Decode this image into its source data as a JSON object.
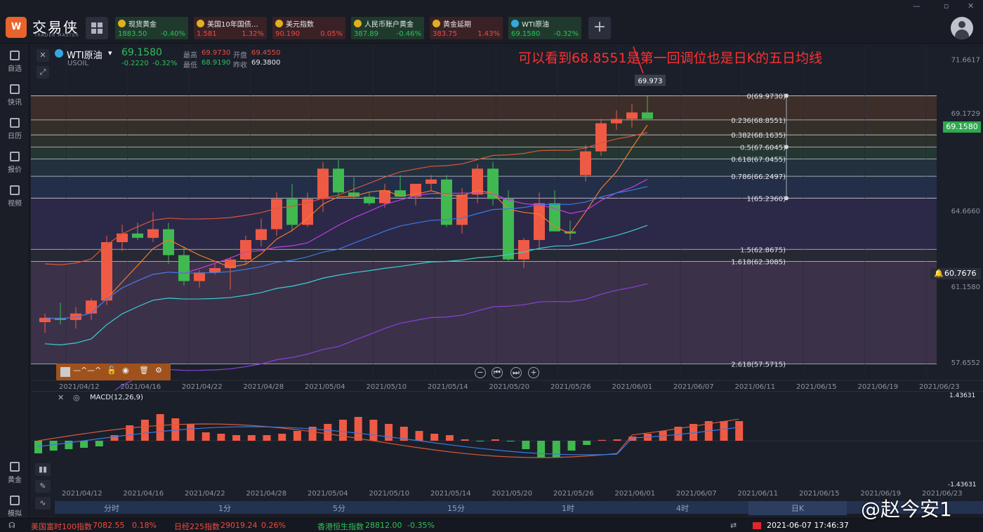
{
  "app": {
    "logo_text": "交易侠",
    "logo_sub": "TRADER MASTER"
  },
  "tickers": [
    {
      "name": "现货黄金",
      "price": "1883.50",
      "change": "-0.40%",
      "color": "#2ec05a",
      "bg": "#1f3a2c"
    },
    {
      "name": "美国10年国债…",
      "price": "1.581",
      "change": "1.32%",
      "color": "#ef4b3f",
      "bg": "#3a2126"
    },
    {
      "name": "美元指数",
      "price": "90.190",
      "change": "0.05%",
      "color": "#ef4b3f",
      "bg": "#3a2126"
    },
    {
      "name": "人民币账户黄金",
      "price": "387.89",
      "change": "-0.46%",
      "color": "#2ec05a",
      "bg": "#1f3a2c"
    },
    {
      "name": "黄金延期",
      "price": "383.75",
      "change": "1.43%",
      "color": "#ef4b3f",
      "bg": "#3a2126"
    },
    {
      "name": "WTI原油",
      "price": "69.1580",
      "change": "-0.32%",
      "color": "#2ec05a",
      "bg": "#1f3a2c"
    }
  ],
  "sidebar": [
    {
      "label": "自选"
    },
    {
      "label": "快讯"
    },
    {
      "label": "日历"
    },
    {
      "label": "报价"
    },
    {
      "label": "视频"
    },
    {
      "label": "黄金"
    },
    {
      "label": "模拟"
    }
  ],
  "symbol": {
    "name": "WTI原油",
    "code": "USOIL",
    "price": "69.1580",
    "change": "-0.2220",
    "change_pct": "-0.32%",
    "high_label": "最高",
    "high": "69.9730",
    "open_label": "开盘",
    "open": "69.4550",
    "low_label": "最低",
    "low": "68.9190",
    "prev_label": "昨收",
    "prev": "69.3800"
  },
  "annotation": "可以看到68.8551是第一回调位也是日K的五日均线",
  "callout_value": "69.973",
  "current_price_tag": "69.1580",
  "alert_price": "60.7676",
  "price_axis": [
    "71.6617",
    "69.1729",
    "64.6660",
    "61.1580",
    "57.6552"
  ],
  "fib_levels": [
    {
      "label": "0(69.9730)",
      "value": 69.973
    },
    {
      "label": "0.236(68.8551)",
      "value": 68.8551
    },
    {
      "label": "0.382(68.1635)",
      "value": 68.1635
    },
    {
      "label": "0.5(67.6045)",
      "value": 67.6045
    },
    {
      "label": "0.618(67.0455)",
      "value": 67.0455
    },
    {
      "label": "0.786(66.2497)",
      "value": 66.2497
    },
    {
      "label": "1(65.2360)",
      "value": 65.236
    },
    {
      "label": "1.5(62.8675)",
      "value": 62.8675
    },
    {
      "label": "1.618(62.3085)",
      "value": 62.3085
    },
    {
      "label": "2.618(57.5715)",
      "value": 57.5715
    }
  ],
  "date_axis": [
    "2021/04/12",
    "2021/04/16",
    "2021/04/22",
    "2021/04/28",
    "2021/05/04",
    "2021/05/10",
    "2021/05/14",
    "2021/05/20",
    "2021/05/26",
    "2021/06/01",
    "2021/06/07",
    "2021/06/11",
    "2021/06/15",
    "2021/06/19",
    "2021/06/23"
  ],
  "macd": {
    "label": "MACD(12,26,9)",
    "top": "1.43631",
    "bottom": "-1.43631"
  },
  "timeframes": [
    "分时",
    "1分",
    "5分",
    "15分",
    "1时",
    "4时",
    "日K"
  ],
  "active_timeframe": "日K",
  "footer": {
    "items": [
      {
        "name": "美国富时100指数",
        "price": "7082.55",
        "change": "0.18%"
      },
      {
        "name": "日经225指数",
        "price": "29019.24",
        "change": "0.26%"
      },
      {
        "name": "香港恒生指数",
        "price": "28812.00",
        "change": "-0.35%"
      }
    ],
    "datetime": "2021-06-07 17:46:37"
  },
  "watermark": "@赵今安1",
  "chart_data": {
    "type": "candlestick",
    "x": [
      "2021/04/12",
      "2021/04/13",
      "2021/04/14",
      "2021/04/15",
      "2021/04/16",
      "2021/04/19",
      "2021/04/20",
      "2021/04/21",
      "2021/04/22",
      "2021/04/23",
      "2021/04/26",
      "2021/04/27",
      "2021/04/28",
      "2021/04/29",
      "2021/04/30",
      "2021/05/03",
      "2021/05/04",
      "2021/05/05",
      "2021/05/06",
      "2021/05/07",
      "2021/05/10",
      "2021/05/11",
      "2021/05/12",
      "2021/05/13",
      "2021/05/14",
      "2021/05/17",
      "2021/05/18",
      "2021/05/19",
      "2021/05/20",
      "2021/05/21",
      "2021/05/24",
      "2021/05/25",
      "2021/05/26",
      "2021/05/27",
      "2021/05/28",
      "2021/05/31",
      "2021/06/01",
      "2021/06/02",
      "2021/06/03",
      "2021/06/04",
      "2021/06/07"
    ],
    "series": [
      {
        "name": "candles",
        "ohlc": [
          [
            59.5,
            59.9,
            59.0,
            59.7
          ],
          [
            59.7,
            60.4,
            59.4,
            59.6
          ],
          [
            59.6,
            60.2,
            59.2,
            59.9
          ],
          [
            59.9,
            60.6,
            59.6,
            60.5
          ],
          [
            60.5,
            63.5,
            60.3,
            63.2
          ],
          [
            63.2,
            64.0,
            62.8,
            63.6
          ],
          [
            63.6,
            64.1,
            63.3,
            63.4
          ],
          [
            63.4,
            64.6,
            63.2,
            63.8
          ],
          [
            63.8,
            64.1,
            62.2,
            62.6
          ],
          [
            62.6,
            63.0,
            61.2,
            61.4
          ],
          [
            61.4,
            61.9,
            61.1,
            61.8
          ],
          [
            61.8,
            62.2,
            61.7,
            62.0
          ],
          [
            62.0,
            62.5,
            61.0,
            62.4
          ],
          [
            62.4,
            63.5,
            62.2,
            63.3
          ],
          [
            63.3,
            64.3,
            63.0,
            63.8
          ],
          [
            63.8,
            65.5,
            63.5,
            65.2
          ],
          [
            65.2,
            65.9,
            63.7,
            64.0
          ],
          [
            64.0,
            65.5,
            63.9,
            65.2
          ],
          [
            65.2,
            66.9,
            64.6,
            66.6
          ],
          [
            66.6,
            67.0,
            65.4,
            65.5
          ],
          [
            65.5,
            66.2,
            65.2,
            65.3
          ],
          [
            65.3,
            65.5,
            64.9,
            65.0
          ],
          [
            65.0,
            65.9,
            64.8,
            65.6
          ],
          [
            65.6,
            66.3,
            65.3,
            65.3
          ],
          [
            65.3,
            65.9,
            64.9,
            65.9
          ],
          [
            65.9,
            66.3,
            65.6,
            66.1
          ],
          [
            66.1,
            66.3,
            63.9,
            64.0
          ],
          [
            64.0,
            65.7,
            63.6,
            65.4
          ],
          [
            65.4,
            66.8,
            65.0,
            66.6
          ],
          [
            66.6,
            66.9,
            64.9,
            65.2
          ],
          [
            65.2,
            65.6,
            62.3,
            62.4
          ],
          [
            62.4,
            63.4,
            62.0,
            63.3
          ],
          [
            63.3,
            65.5,
            62.9,
            65.0
          ],
          [
            65.0,
            65.6,
            63.7,
            63.7
          ],
          [
            63.7,
            64.2,
            63.3,
            63.6
          ]
        ]
      }
    ],
    "ylim": [
      57.0,
      72.0
    ]
  }
}
